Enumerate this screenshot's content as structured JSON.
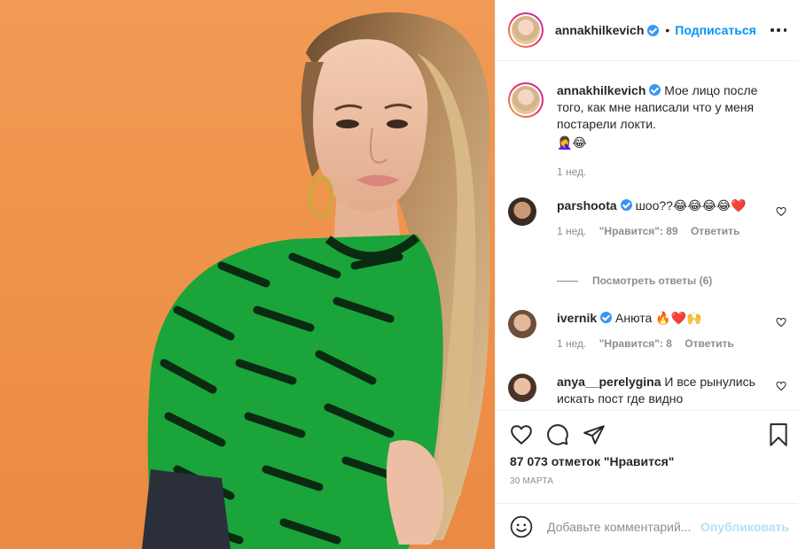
{
  "colors": {
    "background_photo": "#ef9249",
    "follow_blue": "#0095f6",
    "verified_blue": "#3897f0",
    "muted_gray": "#8e8e8e",
    "publish_disabled": "#b2dffc",
    "sweater_green": "#1aa43a"
  },
  "post_image": {
    "alt_icon": "photo-icon"
  },
  "header": {
    "username": "annakhilkevich",
    "separator": "•",
    "follow_label": "Подписаться",
    "more_icon": "more-options-icon"
  },
  "caption": {
    "username": "annakhilkevich",
    "text": "Мое лицо после того, как мне написали что у меня постарели локти.",
    "emoji": "🤦‍♀️😂",
    "time": "1 нед."
  },
  "comments": [
    {
      "username": "parshoota",
      "verified": true,
      "text": "шоо??😂😂😂😂❤️",
      "time": "1 нед.",
      "likes": "\"Нравится\": 89",
      "reply_label": "Ответить",
      "view_replies": "Посмотреть ответы (6)"
    },
    {
      "username": "ivernik",
      "verified": true,
      "text": "Анюта 🔥❤️🙌",
      "time": "1 нед.",
      "likes": "\"Нравится\": 8",
      "reply_label": "Ответить"
    },
    {
      "username": "anya__perelygina",
      "verified": false,
      "text": "И все рынулись искать пост где видно"
    }
  ],
  "actions": {
    "like_icon": "heart-icon",
    "comment_icon": "comment-icon",
    "share_icon": "send-icon",
    "save_icon": "bookmark-icon",
    "likes_text": "87 073 отметок \"Нравится\"",
    "date": "30 МАРТА"
  },
  "add_comment": {
    "emoji_icon": "smile-icon",
    "placeholder": "Добавьте комментарий...",
    "publish_label": "Опубликовать"
  }
}
